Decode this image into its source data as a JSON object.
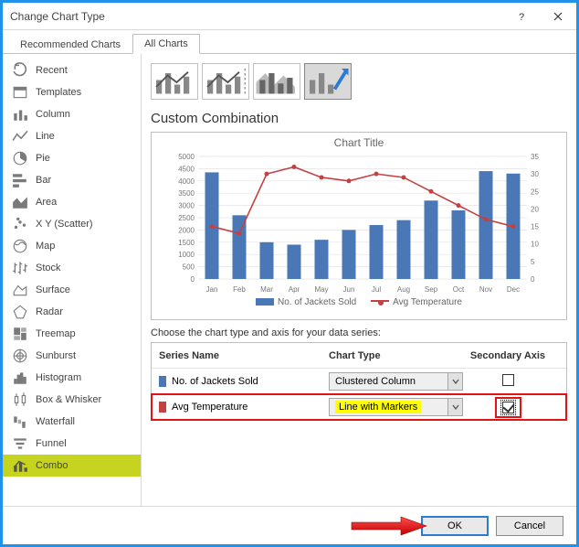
{
  "window": {
    "title": "Change Chart Type"
  },
  "tabs": {
    "recommended": "Recommended Charts",
    "all": "All Charts"
  },
  "sidebar": {
    "items": [
      {
        "label": "Recent"
      },
      {
        "label": "Templates"
      },
      {
        "label": "Column"
      },
      {
        "label": "Line"
      },
      {
        "label": "Pie"
      },
      {
        "label": "Bar"
      },
      {
        "label": "Area"
      },
      {
        "label": "X Y (Scatter)"
      },
      {
        "label": "Map"
      },
      {
        "label": "Stock"
      },
      {
        "label": "Surface"
      },
      {
        "label": "Radar"
      },
      {
        "label": "Treemap"
      },
      {
        "label": "Sunburst"
      },
      {
        "label": "Histogram"
      },
      {
        "label": "Box & Whisker"
      },
      {
        "label": "Waterfall"
      },
      {
        "label": "Funnel"
      },
      {
        "label": "Combo"
      }
    ]
  },
  "section_title": "Custom Combination",
  "preview": {
    "title": "Chart Title",
    "legend1": "No. of Jackets Sold",
    "legend2": "Avg Temperature"
  },
  "series_prompt": "Choose the chart type and axis for your data series:",
  "series_table": {
    "headers": {
      "name": "Series Name",
      "type": "Chart Type",
      "axis": "Secondary Axis"
    },
    "rows": [
      {
        "name": "No. of Jackets Sold",
        "type": "Clustered Column",
        "swatch": "#4a78b6",
        "checked": false
      },
      {
        "name": "Avg Temperature",
        "type": "Line with Markers",
        "swatch": "#c44141",
        "checked": true
      }
    ]
  },
  "footer": {
    "ok": "OK",
    "cancel": "Cancel"
  },
  "chart_data": {
    "type": "combo",
    "title": "Chart Title",
    "categories": [
      "Jan",
      "Feb",
      "Mar",
      "Apr",
      "May",
      "Jun",
      "Jul",
      "Aug",
      "Sep",
      "Oct",
      "Nov",
      "Dec"
    ],
    "series": [
      {
        "name": "No. of Jackets Sold",
        "type": "bar",
        "axis": "primary",
        "color": "#4a78b6",
        "values": [
          4350,
          2600,
          1500,
          1400,
          1600,
          2000,
          2200,
          2400,
          3200,
          2800,
          4400,
          4300
        ]
      },
      {
        "name": "Avg Temperature",
        "type": "line-markers",
        "axis": "secondary",
        "color": "#c44141",
        "values": [
          15,
          13,
          30,
          32,
          29,
          28,
          30,
          29,
          25,
          21,
          17,
          15
        ]
      }
    ],
    "xlabel": "",
    "y_primary": {
      "label": "",
      "min": 0,
      "max": 5000,
      "step": 500
    },
    "y_secondary": {
      "label": "",
      "min": 0,
      "max": 35,
      "step": 5
    }
  }
}
